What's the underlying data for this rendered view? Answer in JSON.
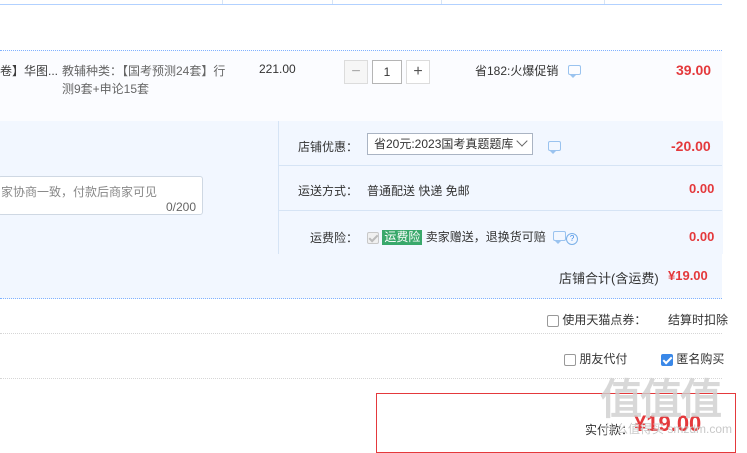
{
  "item": {
    "title_tail": "卷】华图...",
    "sku_line1": "教辅种类：【国考预测24套】行",
    "sku_line2": "测9套+申论15套",
    "unit_price": "221.00",
    "qty_minus": "−",
    "qty_value": "1",
    "qty_plus": "+",
    "promo": "省182:火爆促销",
    "subtotal": "39.00"
  },
  "order": {
    "shop_discount_label": "店铺优惠：",
    "shop_discount_value": "省20元:2023国考真题题库",
    "shop_discount_amount": "-20.00",
    "shipping_label": "运送方式：",
    "shipping_value": "普通配送 快递 免邮",
    "shipping_amount": "0.00",
    "insurance_label": "运费险：",
    "insurance_badge": "运费险",
    "insurance_text": "卖家赠送，退换货可赔",
    "insurance_amount": "0.00",
    "memo_text": "家协商一致，付款后商家可见",
    "memo_count": "0/200"
  },
  "totals": {
    "shop_total_label": "店铺合计(含运费)",
    "shop_total_value": "¥19.00"
  },
  "options": {
    "tmall_points_label": "使用天猫点券：",
    "tmall_points_note": "结算时扣除",
    "pay_for_friend_label": "朋友代付",
    "anonymous_label": "匿名购买"
  },
  "payment": {
    "label": "实付款：",
    "amount": "¥19.00"
  },
  "watermark": "值值值",
  "watermark_site": "什么值得买 smzdm.com"
}
